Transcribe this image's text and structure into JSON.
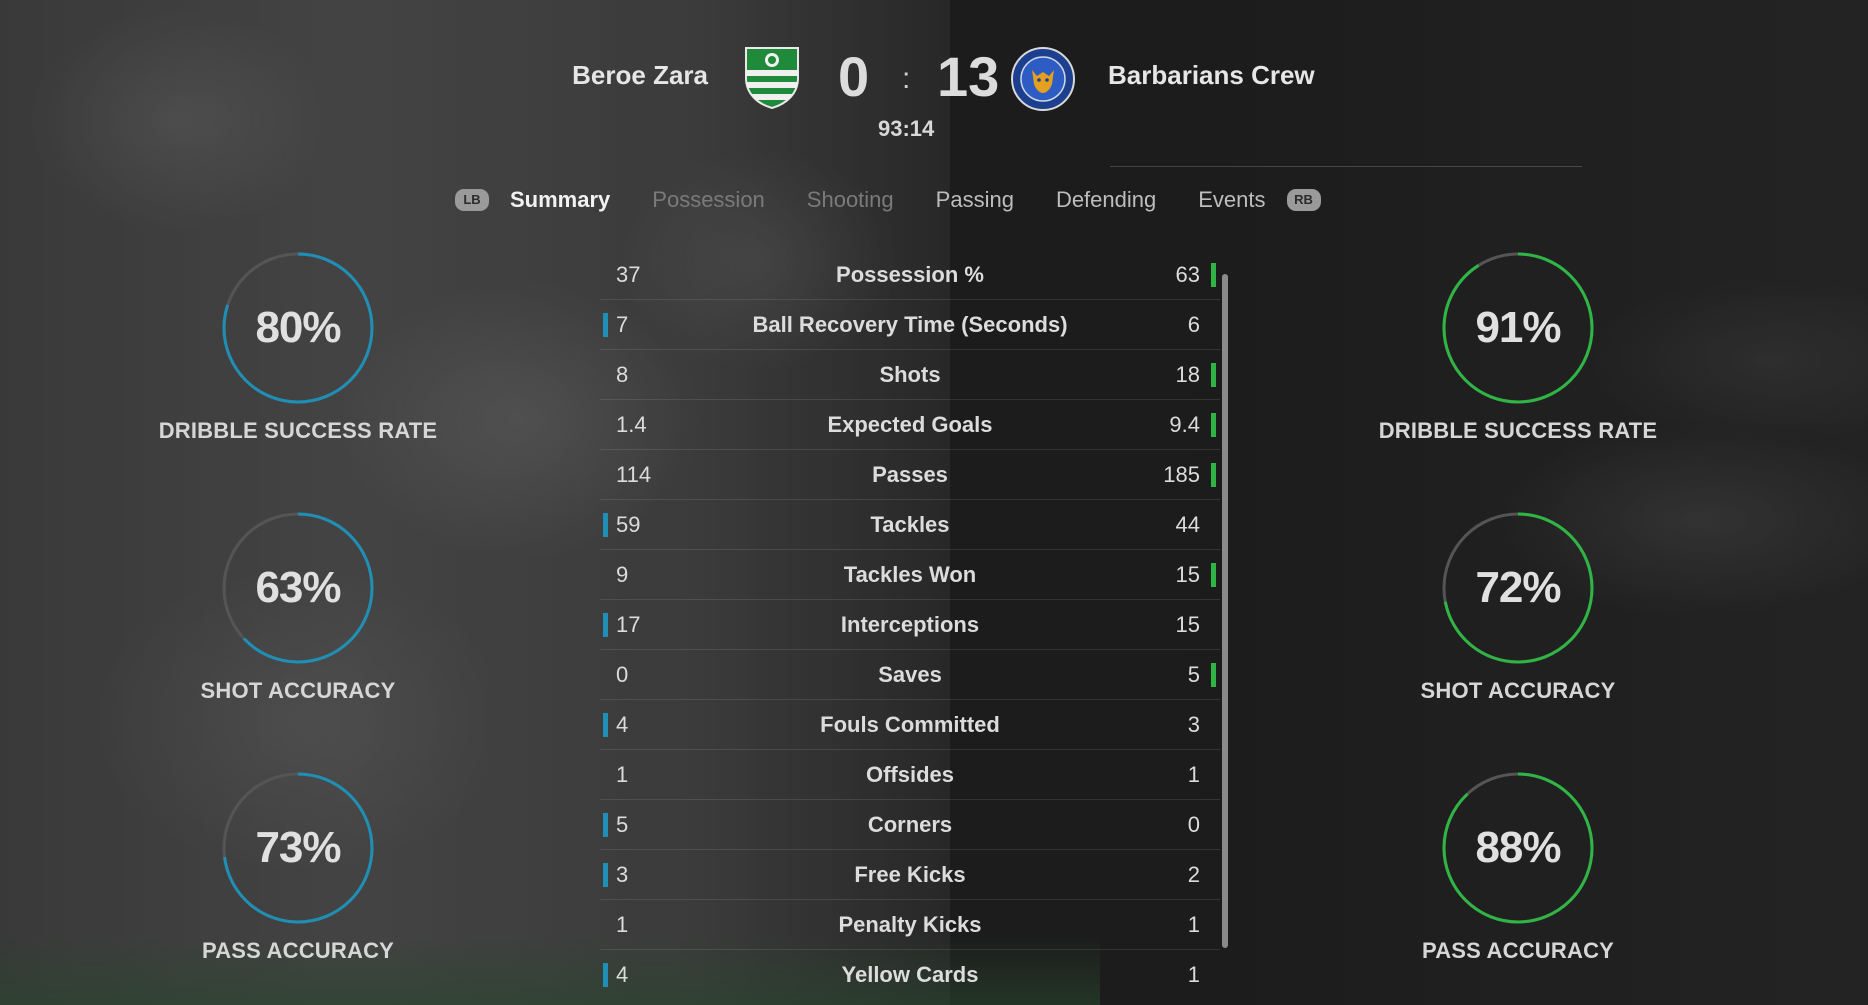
{
  "match": {
    "home_team": "Beroe Zara",
    "away_team": "Barbarians Crew",
    "home_score": "0",
    "away_score": "13",
    "separator": ":",
    "clock": "93:14"
  },
  "tabs": {
    "lb": "LB",
    "rb": "RB",
    "items": [
      "Summary",
      "Possession",
      "Shooting",
      "Passing",
      "Defending",
      "Events"
    ],
    "active": "Summary"
  },
  "home_rings": [
    {
      "value": "80%",
      "label": "DRIBBLE SUCCESS RATE",
      "fraction": 0.8
    },
    {
      "value": "63%",
      "label": "SHOT ACCURACY",
      "fraction": 0.63
    },
    {
      "value": "73%",
      "label": "PASS ACCURACY",
      "fraction": 0.73
    }
  ],
  "away_rings": [
    {
      "value": "91%",
      "label": "DRIBBLE SUCCESS RATE",
      "fraction": 0.91
    },
    {
      "value": "72%",
      "label": "SHOT ACCURACY",
      "fraction": 0.72
    },
    {
      "value": "88%",
      "label": "PASS ACCURACY",
      "fraction": 0.88
    }
  ],
  "stats": [
    {
      "name": "Possession %",
      "home": "37",
      "away": "63",
      "leader": "away"
    },
    {
      "name": "Ball Recovery Time (Seconds)",
      "home": "7",
      "away": "6",
      "leader": "home"
    },
    {
      "name": "Shots",
      "home": "8",
      "away": "18",
      "leader": "away"
    },
    {
      "name": "Expected Goals",
      "home": "1.4",
      "away": "9.4",
      "leader": "away"
    },
    {
      "name": "Passes",
      "home": "114",
      "away": "185",
      "leader": "away"
    },
    {
      "name": "Tackles",
      "home": "59",
      "away": "44",
      "leader": "home"
    },
    {
      "name": "Tackles Won",
      "home": "9",
      "away": "15",
      "leader": "away"
    },
    {
      "name": "Interceptions",
      "home": "17",
      "away": "15",
      "leader": "home"
    },
    {
      "name": "Saves",
      "home": "0",
      "away": "5",
      "leader": "away"
    },
    {
      "name": "Fouls Committed",
      "home": "4",
      "away": "3",
      "leader": "home"
    },
    {
      "name": "Offsides",
      "home": "1",
      "away": "1",
      "leader": "none"
    },
    {
      "name": "Corners",
      "home": "5",
      "away": "0",
      "leader": "home"
    },
    {
      "name": "Free Kicks",
      "home": "3",
      "away": "2",
      "leader": "home"
    },
    {
      "name": "Penalty Kicks",
      "home": "1",
      "away": "1",
      "leader": "none"
    },
    {
      "name": "Yellow Cards",
      "home": "4",
      "away": "1",
      "leader": "home"
    }
  ],
  "colors": {
    "home_accent": "#1f8fb5",
    "away_accent": "#2fb544",
    "ring_track": "#555555"
  },
  "icons": {
    "home_crest": "green-white-striped-shield-icon",
    "away_crest": "blue-fox-crest-icon"
  }
}
